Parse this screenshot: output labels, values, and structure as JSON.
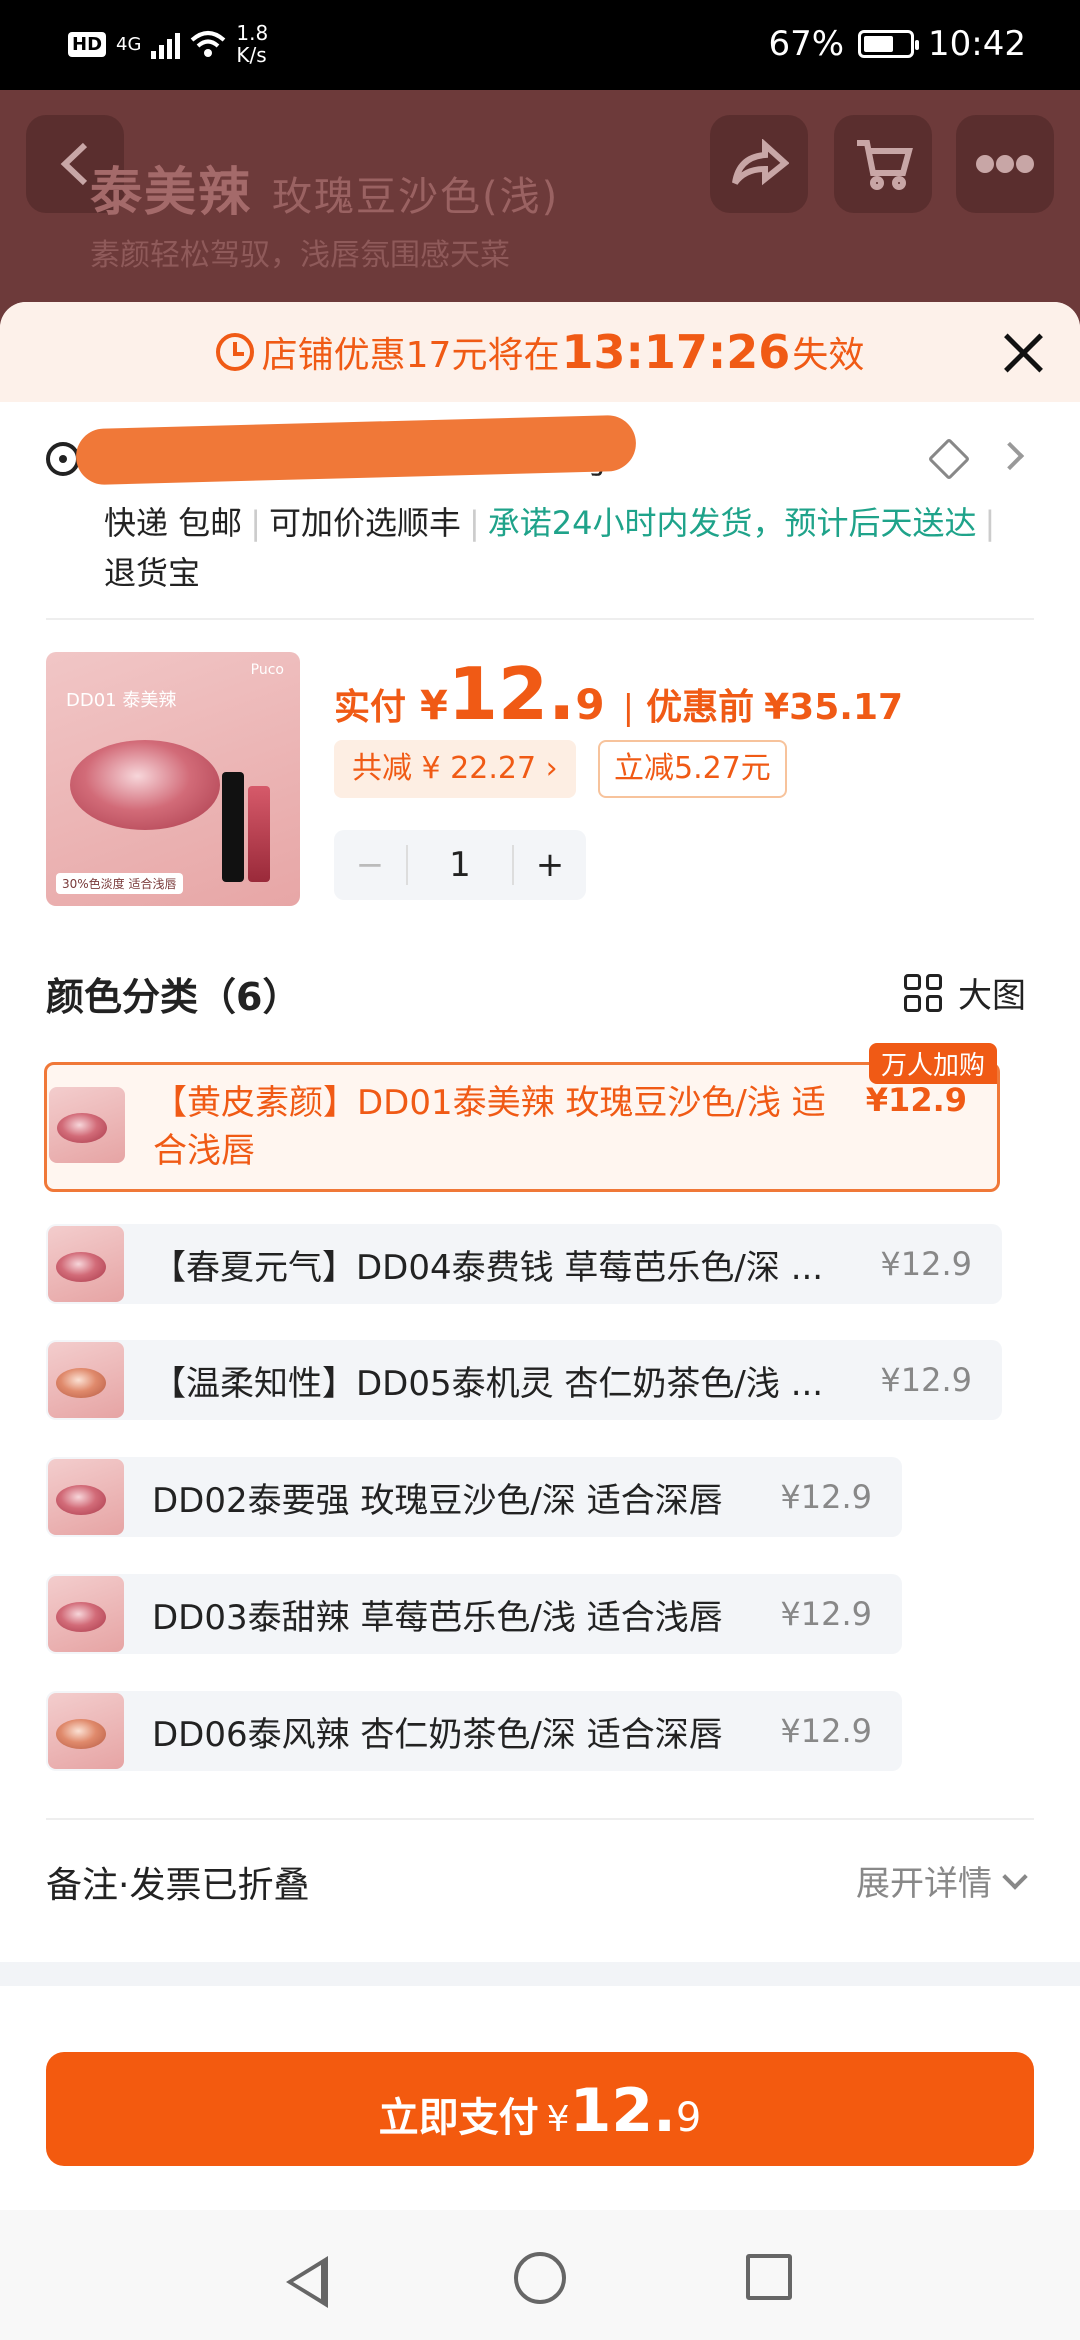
{
  "status_bar": {
    "network": "4G",
    "speed": "1.8",
    "speed_unit": "K/s",
    "battery": "67%",
    "battery_level": 0.67,
    "time": "10:42"
  },
  "background_page": {
    "title_bold": "泰美辣",
    "title_shade": "玫瑰豆沙色(浅)",
    "subtitle": "素颜轻松驾驭，浅唇氛围感天菜"
  },
  "coupon": {
    "prefix": "店铺优惠17元将在",
    "countdown": "13:17:26",
    "suffix": "失效"
  },
  "address": {
    "visible_text": "号",
    "shipping": "快递 包邮",
    "option": "可加价选顺丰",
    "promise": "承诺24小时内发货，预计后天送达",
    "return": "退货宝"
  },
  "product": {
    "thumb_title": "DD01 泰美辣",
    "thumb_brand": "Puco",
    "thumb_shade": "玫瑰豆沙色(浅)",
    "thumb_badge": "30%色淡度 适合浅唇",
    "price_label": "实付",
    "currency": "¥",
    "price_int": "12.",
    "price_dec": "9",
    "before_label": "优惠前",
    "before_price": "¥35.17",
    "total_discount": "共减 ¥ 22.27 ›",
    "instant_discount": "立减5.27元",
    "quantity": "1",
    "minus": "−",
    "plus": "+"
  },
  "colors": {
    "title": "颜色分类（6）",
    "big_image": "大图",
    "hot_tag": "万人加购",
    "options": [
      {
        "label": "【黄皮素颜】DD01泰美辣 玫瑰豆沙色/浅 适合浅唇",
        "price": "¥12.9"
      },
      {
        "label": "【春夏元气】DD04泰费钱 草莓芭乐色/深 ...",
        "price": "¥12.9"
      },
      {
        "label": "【温柔知性】DD05泰机灵 杏仁奶茶色/浅 ...",
        "price": "¥12.9"
      },
      {
        "label": "DD02泰要强 玫瑰豆沙色/深 适合深唇",
        "price": "¥12.9"
      },
      {
        "label": "DD03泰甜辣 草莓芭乐色/浅 适合浅唇",
        "price": "¥12.9"
      },
      {
        "label": "DD06泰风辣 杏仁奶茶色/深 适合深唇",
        "price": "¥12.9"
      }
    ]
  },
  "remark": {
    "label": "备注·发票已折叠",
    "expand": "展开详情"
  },
  "pay": {
    "label": "立即支付",
    "currency": "¥",
    "int": "12.",
    "dec": "9"
  },
  "colors_theme": {
    "accent": "#f05a15",
    "promise_green": "#1fa38a"
  }
}
